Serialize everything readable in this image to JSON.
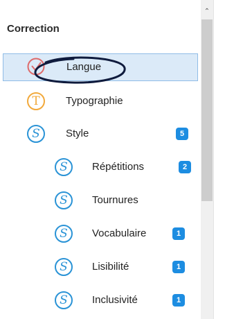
{
  "panel": {
    "title": "Correction",
    "items": [
      {
        "label": "Langue",
        "icon": "spellcheck-icon",
        "glyph": "",
        "badge": null,
        "selected": true
      },
      {
        "label": "Typographie",
        "icon": "typography-icon",
        "glyph": "T",
        "badge": null
      },
      {
        "label": "Style",
        "icon": "style-icon",
        "glyph": "S",
        "badge": "5"
      },
      {
        "label": "Répétitions",
        "icon": "style-icon",
        "glyph": "S",
        "badge": "2"
      },
      {
        "label": "Tournures",
        "icon": "style-icon",
        "glyph": "S",
        "badge": null
      },
      {
        "label": "Vocabulaire",
        "icon": "style-icon",
        "glyph": "S",
        "badge": "1"
      },
      {
        "label": "Lisibilité",
        "icon": "style-icon",
        "glyph": "S",
        "badge": "1"
      },
      {
        "label": "Inclusivité",
        "icon": "style-icon",
        "glyph": "S",
        "badge": "1"
      }
    ]
  },
  "colors": {
    "accent": "#1d8de1",
    "style_icon": "#2a93d6",
    "typography_icon": "#f2a93b",
    "spellcheck_icon": "#de6b6b",
    "selection": "#dbeaf8",
    "annotation_ink": "#0f1b3d"
  },
  "scrollbar": {
    "up_arrow": "⌃"
  }
}
